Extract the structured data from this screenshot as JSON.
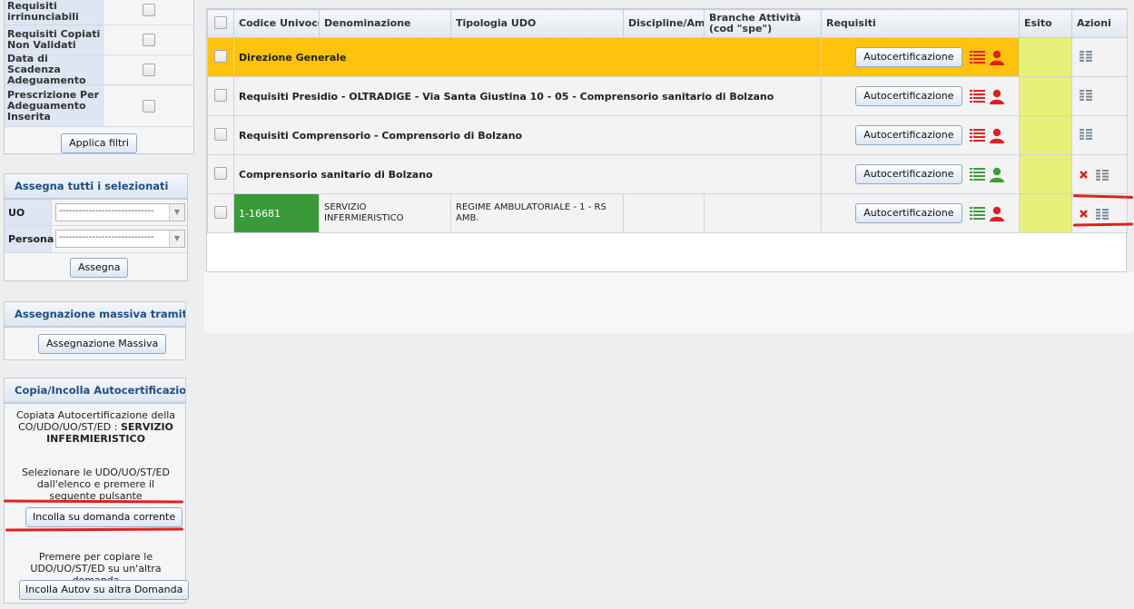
{
  "filters": {
    "rows": [
      {
        "label": "Requisiti irrinunciabili"
      },
      {
        "label": "Requisiti Copiati Non Validati"
      },
      {
        "label": "Data di Scadenza Adeguamento"
      },
      {
        "label": "Prescrizione Per Adeguamento Inserita"
      }
    ],
    "apply_label": "Applica filtri"
  },
  "assign": {
    "title": "Assegna tutti i selezionati",
    "uo_label": "UO",
    "persona_label": "Persona",
    "uo_value": "-----------------------------",
    "persona_value": "-----------------------------",
    "button_label": "Assegna"
  },
  "mass": {
    "title": "Assegnazione massiva tramite UO",
    "button_label": "Assegnazione Massiva"
  },
  "copy": {
    "title": "Copia/Incolla Autocertificazione",
    "copied_text": "Copiata Autocertificazione della CO/UDO/UO/ST/ED :",
    "copied_name": "SERVIZIO INFERMIERISTICO",
    "select_text": "Selezionare le UDO/UO/ST/ED dall'elenco e premere il seguente pulsante",
    "paste_label": "Incolla su domanda corrente",
    "copy_other_text": "Premere per copiare le UDO/UO/ST/ED su un'altra domanda",
    "paste_other_label": "Incolla Autov su altra Domanda"
  },
  "table": {
    "headers": {
      "codice": "Codice Univoco",
      "denominazione": "Denominazione",
      "tipologia": "Tipologia UDO",
      "discipline": "Discipline/Ambiti",
      "branche": "Branche Attività (cod \"spe\")",
      "requisiti": "Requisiti",
      "esito": "Esito",
      "azioni": "Azioni"
    },
    "rows": [
      {
        "title": "Direzione Generale",
        "button": "Autocertificazione"
      },
      {
        "title": "Requisiti Presidio - OLTRADIGE - Via Santa Giustina 10 - 05 - Comprensorio sanitario di Bolzano",
        "button": "Autocertificazione"
      },
      {
        "title": "Requisiti Comprensorio - Comprensorio di Bolzano",
        "button": "Autocertificazione"
      },
      {
        "title": "Comprensorio sanitario di Bolzano",
        "button": "Autocertificazione"
      }
    ],
    "udo_row": {
      "codice": "1-16681",
      "denominazione": "SERVIZIO INFERMIERISTICO",
      "tipologia": "REGIME AMBULATORIALE - 1 - RS AMB.",
      "discipline": "",
      "branche": "",
      "button": "Autocertificazione"
    }
  },
  "colors": {
    "header_text": "#1f4e84",
    "highlight_row": "#ffc20e",
    "esito_bg": "#e9f078",
    "udo_code_bg": "#3a9a3a",
    "list_red": "#e02020",
    "list_green": "#3b9e3b"
  }
}
